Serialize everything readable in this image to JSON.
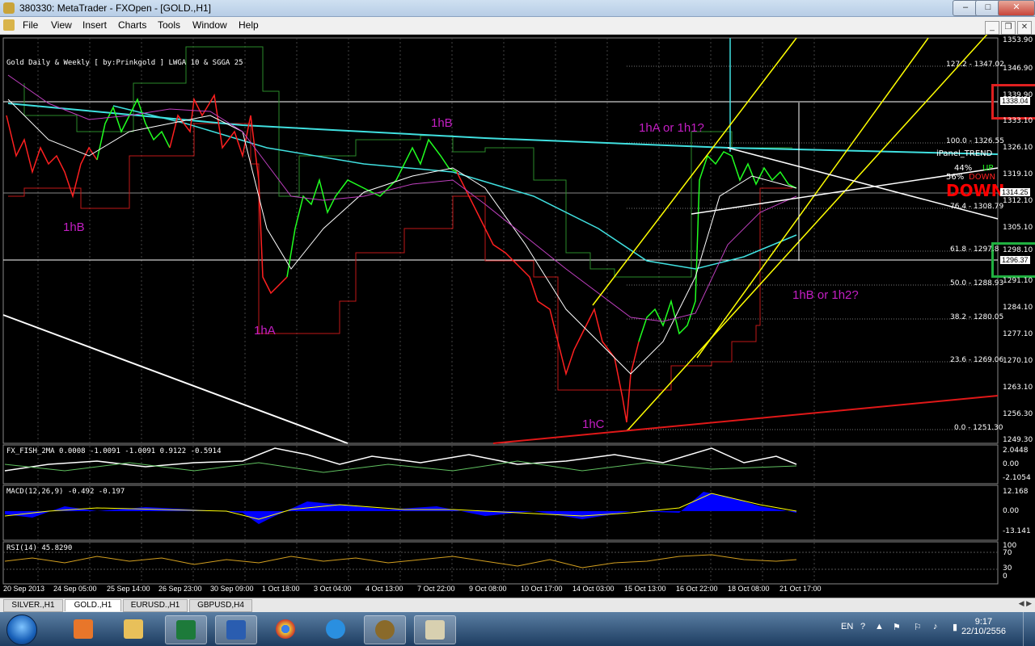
{
  "window": {
    "title": "380330: MetaTrader - FXOpen - [GOLD.,H1]"
  },
  "menu": [
    "File",
    "View",
    "Insert",
    "Charts",
    "Tools",
    "Window",
    "Help"
  ],
  "chart": {
    "info_line": "Gold Daily & Weekly [ by:Prinkgold ]  LWGA 10  &  SGGA 25",
    "price_axis": [
      "1353.90",
      "1346.90",
      "1339.90",
      "1333.10",
      "1326.10",
      "1319.10",
      "1312.10",
      "1305.10",
      "1298.10",
      "1291.10",
      "1284.10",
      "1277.10",
      "1270.10",
      "1263.10",
      "1256.30",
      "1249.30"
    ],
    "price_highlight_top": "1338.04",
    "price_highlight_bottom": "1296.37",
    "price_current": "1314.25",
    "fib_levels": [
      "127.2 - 1347.02",
      "100.0 - 1326.55",
      "76.4 - 1308.79",
      "61.8 - 1297.8",
      "50.0 - 1288.93",
      "38.2 - 1280.05",
      "23.6 - 1269.06",
      "0.0 - 1251.30"
    ],
    "annotations": {
      "label_1hB_top": "1hB",
      "label_1hB_left": "1hB",
      "label_1hA": "1hA",
      "label_1hC": "1hC",
      "label_1hA_or_1h1": "1hA or 1h1?",
      "label_1hB_or_1h2": "1hB or 1h2?"
    },
    "ipanel": {
      "name": "iPanel_TREND",
      "up_pct": "44%",
      "up_label": "UP",
      "down_pct": "56%",
      "down_label": "DOWN",
      "big_label": "DOWN"
    },
    "fisher": {
      "info": "FX_FISH_2MA 0.0008 -1.0091 -1.0091 0.9122 -0.5914",
      "axis": [
        "2.0448",
        "0.00",
        "-2.1054"
      ]
    },
    "macd": {
      "info": "MACD(12,26,9) -0.492 -0.197",
      "axis": [
        "12.168",
        "0.00",
        "-13.141"
      ]
    },
    "rsi": {
      "info": "RSI(14) 45.8290",
      "axis": [
        "100",
        "70",
        "30",
        "0"
      ]
    },
    "date_axis": [
      "20 Sep 2013",
      "24 Sep 05:00",
      "25 Sep 14:00",
      "26 Sep 23:00",
      "30 Sep 09:00",
      "1 Oct 18:00",
      "3 Oct 04:00",
      "4 Oct 13:00",
      "7 Oct 22:00",
      "9 Oct 08:00",
      "10 Oct 17:00",
      "14 Oct 03:00",
      "15 Oct 13:00",
      "16 Oct 22:00",
      "18 Oct 08:00",
      "21 Oct 17:00"
    ],
    "colors": {
      "bull": "#00ff00",
      "bear": "#ff0000",
      "channel": "#ffff00",
      "trend": "#40e0e0",
      "ma_purple": "#c040c0"
    }
  },
  "tabs": [
    "SILVER.,H1",
    "GOLD.,H1",
    "EURUSD.,H1",
    "GBPUSD,H4"
  ],
  "taskbar": {
    "apps": [
      "media-player-icon",
      "file-manager-icon",
      "excel-icon",
      "word-icon",
      "chrome-icon",
      "ie-icon",
      "metatrader-icon",
      "paint-icon"
    ],
    "lang": "EN",
    "time": "9:17",
    "date": "22/10/2556"
  }
}
